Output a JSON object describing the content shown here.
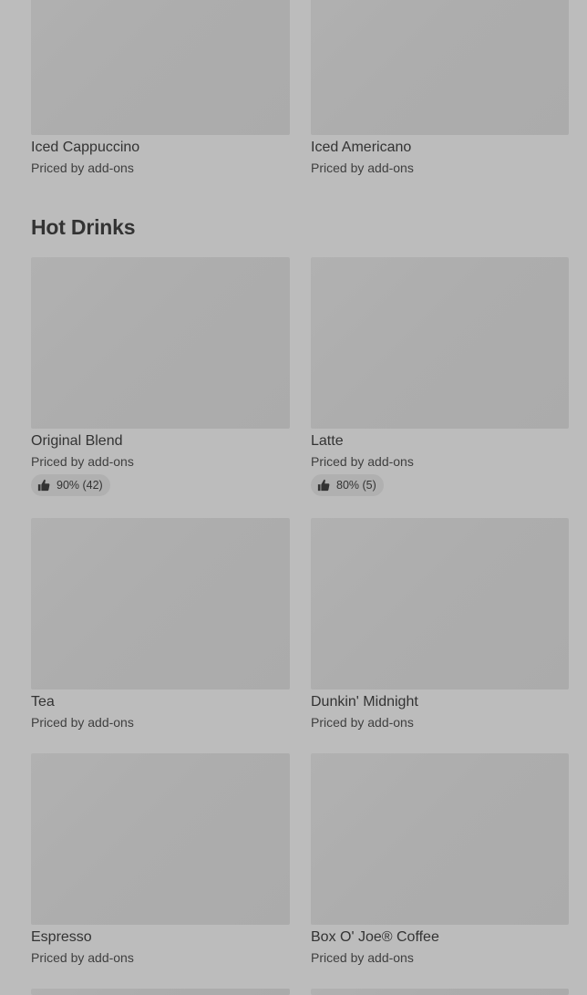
{
  "top_items": [
    {
      "name": "Iced Cappuccino",
      "price": "Priced by add-ons"
    },
    {
      "name": "Iced Americano",
      "price": "Priced by add-ons"
    }
  ],
  "hot_drinks": {
    "title": "Hot Drinks",
    "items": [
      {
        "name": "Original Blend",
        "price": "Priced by add-ons",
        "rating": "90% (42)",
        "rating_icon": "thumbs-up-icon"
      },
      {
        "name": "Latte",
        "price": "Priced by add-ons",
        "rating": "80% (5)",
        "rating_icon": "thumbs-up-icon"
      },
      {
        "name": "Tea",
        "price": "Priced by add-ons"
      },
      {
        "name": "Dunkin' Midnight",
        "price": "Priced by add-ons"
      },
      {
        "name": "Espresso",
        "price": "Priced by add-ons"
      },
      {
        "name": "Box O' Joe® Coffee",
        "price": "Priced by add-ons"
      }
    ]
  },
  "colors": {
    "overlay_background": "#bcbcbc",
    "image_placeholder": "#adadad",
    "text": "#333333"
  }
}
